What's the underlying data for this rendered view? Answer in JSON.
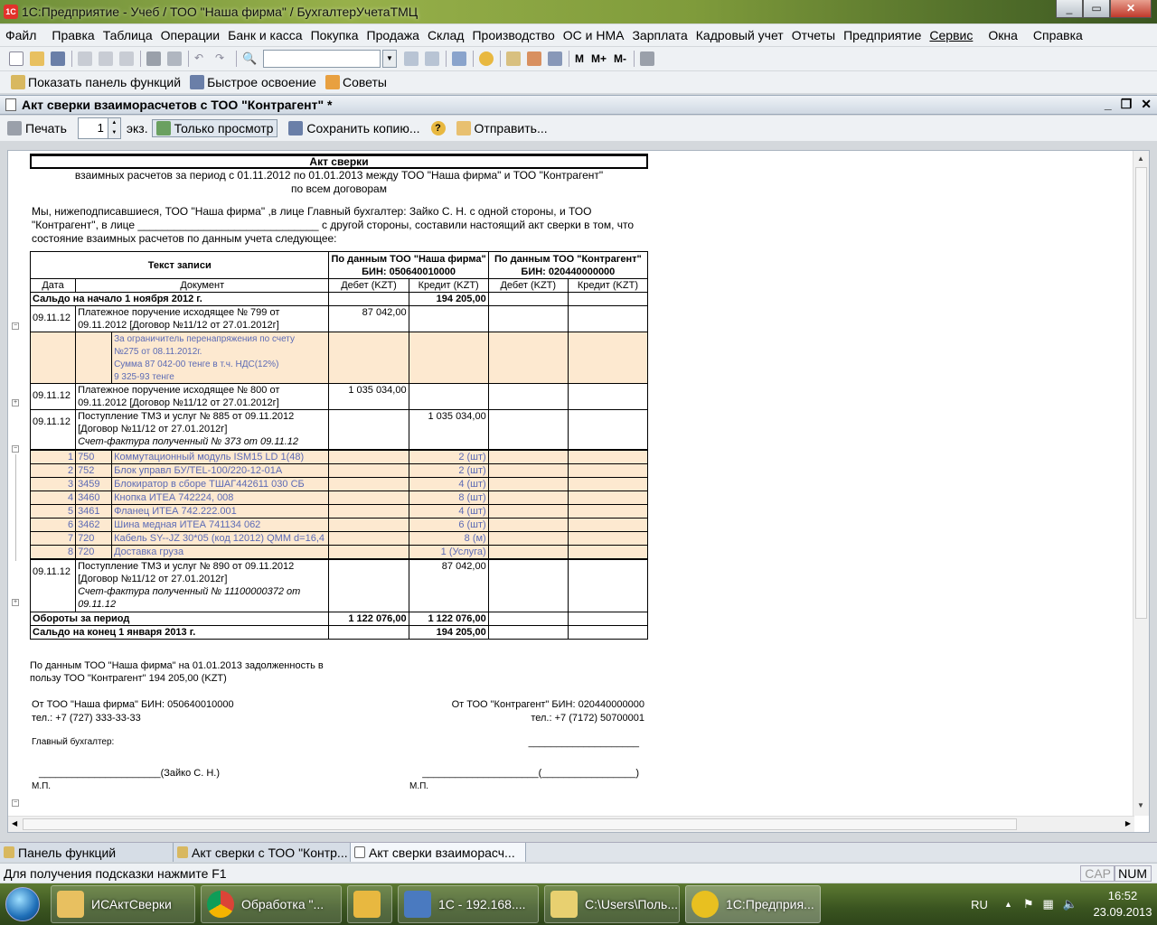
{
  "window": {
    "title": "1С:Предприятие - Учеб / ТОО \"Наша фирма\" / БухгалтерУчетаТМЦ",
    "minimize": "_",
    "maximize": "▭",
    "close": "✕"
  },
  "menu": [
    "Файл",
    "Правка",
    "Таблица",
    "Операции",
    "Банк и касса",
    "Покупка",
    "Продажа",
    "Склад",
    "Производство",
    "ОС и НМА",
    "Зарплата",
    "Кадровый учет",
    "Отчеты",
    "Предприятие",
    "Сервис",
    "Окна",
    "Справка"
  ],
  "toolbar2": {
    "show_panel": "Показать панель функций",
    "quick_learning": "Быстрое освоение",
    "tips": "Советы"
  },
  "toolbar1": {
    "m": "M",
    "m_plus": "M+",
    "m_minus": "M-"
  },
  "doc_window": {
    "title": "Акт сверки взаиморасчетов с ТОО \"Контрагент\" *",
    "min": "_",
    "restore": "❐",
    "close": "✕"
  },
  "doc_toolbar": {
    "print": "Печать",
    "copies": "1",
    "copies_unit": "экз.",
    "view_only": "Только просмотр",
    "save_copy": "Сохранить копию...",
    "help": "?",
    "send": "Отправить..."
  },
  "report": {
    "title": "Акт сверки",
    "subtitle1": "взаимных расчетов за период с 01.11.2012 по 01.01.2013 между ТОО \"Наша фирма\" и ТОО \"Контрагент\"",
    "subtitle2": "по всем договорам",
    "intro1": "Мы, нижеподписавшиеся, ТОО \"Наша фирма\" ,в лице Главный бухгалтер: Зайко С. Н. с одной стороны, и ТОО",
    "intro2": "\"Контрагент\", в лице ______________________________ с другой стороны, составили настоящий акт сверки в том, что",
    "intro3": "состояние взаимных расчетов по данным учета следующее:",
    "headers": {
      "record_text": "Текст записи",
      "our_side": "По данным ТОО \"Наша фирма\" БИН: 050640010000",
      "their_side": "По данным ТОО \"Контрагент\" БИН: 020440000000",
      "date": "Дата",
      "document": "Документ",
      "debit": "Дебет (KZT)",
      "credit": "Кредит (KZT)"
    },
    "opening": {
      "label": "Сальдо на начало 1 ноября 2012 г.",
      "credit": "194 205,00"
    },
    "rows": [
      {
        "date": "09.11.12",
        "doc1": "Платежное поручение исходящее № 799 от",
        "doc2": "09.11.2012 [Договор №11/12 от 27.01.2012г]",
        "debit": "87 042,00",
        "credit": ""
      },
      {
        "date": "09.11.12",
        "doc1": "Платежное поручение исходящее № 800 от",
        "doc2": "09.11.2012 [Договор №11/12 от 27.01.2012г]",
        "debit": "1 035 034,00",
        "credit": ""
      },
      {
        "date": "09.11.12",
        "doc1": "Поступление ТМЗ и услуг № 885 от 09.11.2012",
        "doc2": "[Договор №11/12 от 27.01.2012г]",
        "doc3": "Счет-фактура полученный № 373 от 09.11.12",
        "debit": "",
        "credit": "1 035 034,00"
      },
      {
        "date": "09.11.12",
        "doc1": "Поступление ТМЗ и услуг № 890 от 09.11.2012",
        "doc2": "[Договор №11/12 от 27.01.2012г]",
        "doc3": "Счет-фактура полученный № 11100000372 от",
        "doc4": "09.11.12",
        "debit": "",
        "credit": "87 042,00"
      }
    ],
    "detail": {
      "l1": "За  ограничитель перенапряжения по счету",
      "l2": "№275  от  08.11.2012г.",
      "l3": "Сумма 87 042-00 тенге в т.ч. НДС(12%)",
      "l4": "9 325-93 тенге"
    },
    "items": [
      {
        "n": "1",
        "code": "750",
        "name": "Коммутационный модуль ISM15 LD 1(48)",
        "qty": "2 (шт)"
      },
      {
        "n": "2",
        "code": "752",
        "name": "Блок управл БУ/TEL-100/220-12-01A",
        "qty": "2 (шт)"
      },
      {
        "n": "3",
        "code": "3459",
        "name": "Блокиратор в сборе ТШАГ442611 030 СБ",
        "qty": "4 (шт)"
      },
      {
        "n": "4",
        "code": "3460",
        "name": "Кнопка ИТЕА 742224, 008",
        "qty": "8 (шт)"
      },
      {
        "n": "5",
        "code": "3461",
        "name": "Фланец ИТЕА 742.222.001",
        "qty": "4 (шт)"
      },
      {
        "n": "6",
        "code": "3462",
        "name": "Шина медная ИТЕА 741134 062",
        "qty": "6 (шт)"
      },
      {
        "n": "7",
        "code": "720",
        "name": "Кабель SY--JZ 30*05 (код 12012) QMM d=16,4",
        "qty": "8 (м)"
      },
      {
        "n": "8",
        "code": "720",
        "name": "Доставка груза",
        "qty": "1 (Услуга)"
      }
    ],
    "turnover": {
      "label": "Обороты за период",
      "debit": "1 122 076,00",
      "credit": "1 122 076,00"
    },
    "closing": {
      "label": "Сальдо на конец 1 января 2013 г.",
      "credit": "194 205,00"
    },
    "summary1": "По данным ТОО \"Наша фирма\" на 01.01.2013 задолженность в",
    "summary2": "пользу ТОО \"Контрагент\"  194 205,00 (KZT)",
    "from_our": "От ТОО \"Наша фирма\" БИН: 050640010000",
    "our_phone": " тел.: +7 (727) 333-33-33",
    "from_their": "От ТОО \"Контрагент\" БИН: 020440000000",
    "their_phone": "тел.: +7 (7172) 50700001",
    "chief_acc": "Главный бухгалтер:",
    "sign_our": "______________________(Зайко С. Н.)",
    "sign_their": "_____________________(_________________)",
    "mp": "М.П.",
    "line": "____________________"
  },
  "window_tabs": [
    "Панель функций",
    "Акт сверки с ТОО \"Контр...",
    "Акт сверки взаиморасч..."
  ],
  "status": {
    "hint": "Для получения подсказки нажмите F1",
    "cap": "CAP",
    "num": "NUM"
  },
  "taskbar": {
    "items": [
      "ИСАктСверки",
      "Обработка \"...",
      "",
      "1С - 192.168....",
      "C:\\Users\\Поль...",
      "1С:Предприя..."
    ],
    "lang": "RU",
    "time": "16:52",
    "date": "23.09.2013"
  }
}
